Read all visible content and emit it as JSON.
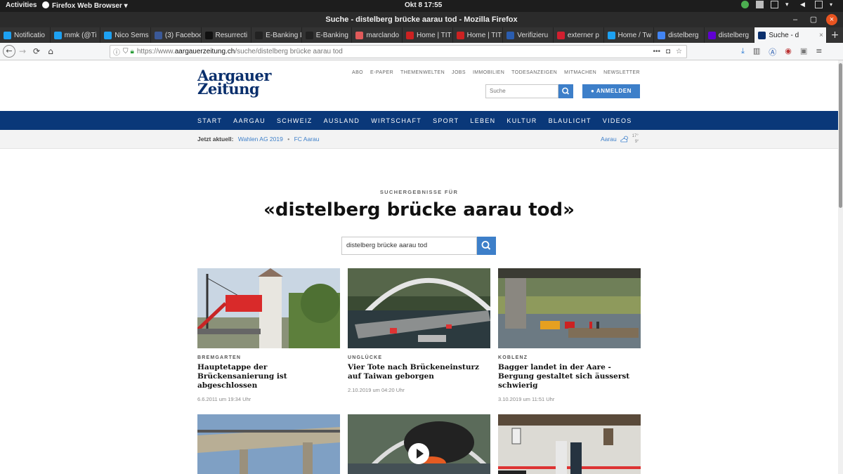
{
  "gnome": {
    "activities": "Activities",
    "app_menu": "Firefox Web Browser ▾",
    "clock": "Okt 8  17:55"
  },
  "window": {
    "title": "Suche - distelberg brücke aarau tod - Mozilla Firefox"
  },
  "tabs": [
    {
      "label": "Notificatio",
      "color": "#1da1f2"
    },
    {
      "label": "mmk (@Ti",
      "color": "#1da1f2"
    },
    {
      "label": "Nico Sems",
      "color": "#1da1f2"
    },
    {
      "label": "(3) Faceboo",
      "color": "#3b5998"
    },
    {
      "label": "Resurrecti",
      "color": "#111111"
    },
    {
      "label": "E-Banking L",
      "color": "#222222"
    },
    {
      "label": "E-Banking",
      "color": "#222222"
    },
    {
      "label": "marclando",
      "color": "#e05a5a"
    },
    {
      "label": "Home | TIT",
      "color": "#cc2222"
    },
    {
      "label": "Home | TIT",
      "color": "#cc2222"
    },
    {
      "label": "Verifizieru",
      "color": "#2a5db0"
    },
    {
      "label": "externer p",
      "color": "#d11f2f"
    },
    {
      "label": "Home / Tw",
      "color": "#1da1f2"
    },
    {
      "label": "distelberg",
      "color": "#4285f4"
    },
    {
      "label": "distelberg",
      "color": "#6001d2"
    },
    {
      "label": "Suche - d",
      "color": "#0a2f6c",
      "active": true
    }
  ],
  "urlbar": {
    "prefix": "https://www.",
    "host": "aargauerzeitung.ch",
    "path": "/suche/distelberg brücke aarau tod",
    "dots": "•••"
  },
  "site": {
    "logo_line1": "Aargauer",
    "logo_line2": "Zeitung",
    "toplinks": [
      "ABO",
      "E-PAPER",
      "THEMENWELTEN",
      "JOBS",
      "IMMOBILIEN",
      "TODESANZEIGEN",
      "MITMACHEN",
      "NEWSLETTER"
    ],
    "search_placeholder": "Suche",
    "login_label": "ANMELDEN",
    "nav": [
      "START",
      "AARGAU",
      "SCHWEIZ",
      "AUSLAND",
      "WIRTSCHAFT",
      "SPORT",
      "LEBEN",
      "KULTUR",
      "BLAULICHT",
      "VIDEOS"
    ],
    "current_label": "Jetzt aktuell:",
    "current_topics": [
      "Wahlen AG 2019",
      "FC Aarau"
    ],
    "weather_city": "Aarau",
    "weather_high": "17°",
    "weather_low": "9°"
  },
  "results": {
    "kicker": "SUCHERGEBNISSE FÜR",
    "title": "«distelberg brücke aarau tod»",
    "query": "distelberg brücke aarau tod"
  },
  "cards": [
    {
      "kicker": "BREMGARTEN",
      "headline": "Hauptetappe der Brückensanierung ist abgeschlossen",
      "date": "6.6.2011 um 19:34 Uhr"
    },
    {
      "kicker": "UNGLÜCKE",
      "headline": "Vier Tote nach Brückeneinsturz auf Taiwan geborgen",
      "date": "2.10.2019 um 04:20 Uhr"
    },
    {
      "kicker": "KOBLENZ",
      "headline": "Bagger landet in der Aare - Bergung gestaltet sich äusserst schwierig",
      "date": "3.10.2019 um 11:51 Uhr"
    }
  ],
  "colors": {
    "brand": "#0a2f6c",
    "nav_bg": "#0a3879",
    "accent": "#3d7fc9"
  }
}
